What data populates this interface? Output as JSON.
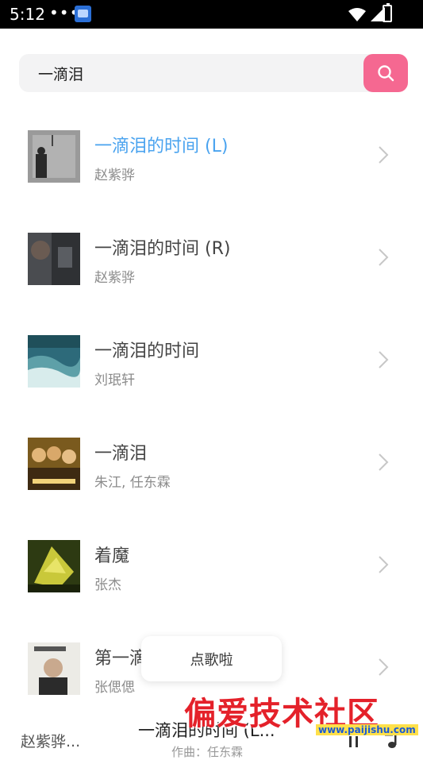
{
  "status_bar": {
    "time": "5:12",
    "dots": "•••"
  },
  "search": {
    "value": "一滴泪"
  },
  "songs": [
    {
      "title": "一滴泪的时间 (L)",
      "artist": "赵紫骅",
      "active": true
    },
    {
      "title": "一滴泪的时间 (R)",
      "artist": "赵紫骅",
      "active": false
    },
    {
      "title": "一滴泪的时间",
      "artist": "刘珉轩",
      "active": false
    },
    {
      "title": "一滴泪",
      "artist": "朱江, 任东霖",
      "active": false
    },
    {
      "title": "着魔",
      "artist": "张杰",
      "active": false
    },
    {
      "title": "第一滴泪",
      "artist": "张偲偲",
      "active": false
    }
  ],
  "toast": {
    "text": "点歌啦"
  },
  "player": {
    "artist": "赵紫骅...",
    "title": "一滴泪的时间 (L...",
    "subtitle": "作曲：任东霖"
  },
  "watermark": {
    "text": "偏爱技术社区",
    "url": "www.paijishu.com"
  },
  "colors": {
    "accent": "#4aa3ef",
    "search_button": "#f56891"
  }
}
